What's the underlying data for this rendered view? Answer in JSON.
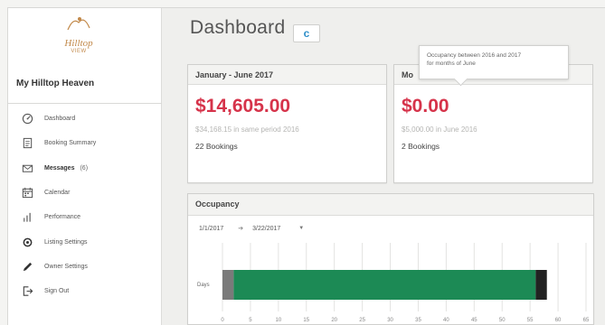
{
  "sidebar": {
    "logo_text": "Hilltop",
    "logo_sub": "VIEW",
    "property_name": "My Hilltop Heaven",
    "items": [
      {
        "label": "Dashboard",
        "icon": "dashboard-icon",
        "bold": false,
        "count": ""
      },
      {
        "label": "Booking Summary",
        "icon": "booking-summary-icon",
        "bold": false,
        "count": ""
      },
      {
        "label": "Messages",
        "icon": "envelope-icon",
        "bold": true,
        "count": "(6)"
      },
      {
        "label": "Calendar",
        "icon": "calendar-icon",
        "bold": false,
        "count": ""
      },
      {
        "label": "Performance",
        "icon": "bar-chart-icon",
        "bold": false,
        "count": ""
      },
      {
        "label": "Listing Settings",
        "icon": "gear-icon",
        "bold": false,
        "count": ""
      },
      {
        "label": "Owner Settings",
        "icon": "pencil-icon",
        "bold": false,
        "count": ""
      },
      {
        "label": "Sign Out",
        "icon": "sign-out-icon",
        "bold": false,
        "count": ""
      }
    ]
  },
  "main": {
    "title": "Dashboard",
    "refresh_label": "c"
  },
  "cards": [
    {
      "header": "January - June 2017",
      "amount": "$14,605.00",
      "comparison": "$34,168.15 in same period 2016",
      "bookings": "22 Bookings"
    },
    {
      "header": "Mo",
      "amount": "$0.00",
      "comparison": "$5,000.00 in June 2016",
      "bookings": "2 Bookings"
    }
  ],
  "tooltip": {
    "line1": "Occupancy between 2016 and 2017",
    "line2": "for months of June"
  },
  "occupancy": {
    "header": "Occupancy",
    "start_date": "1/1/2017",
    "end_date": "3/22/2017",
    "row_label": "Days",
    "accent_color": "#1c8a55"
  },
  "chart_data": {
    "type": "bar",
    "orientation": "horizontal",
    "categories": [
      "Days"
    ],
    "series": [
      {
        "color": "#7a7a7a",
        "start": 0,
        "end": 2
      },
      {
        "color": "#1c8a55",
        "start": 2,
        "end": 56
      },
      {
        "color": "#222222",
        "start": 56,
        "end": 58
      }
    ],
    "x_ticks": [
      "0",
      "5",
      "10",
      "15",
      "20",
      "25",
      "30",
      "35",
      "40",
      "45",
      "50",
      "55",
      "60",
      "65"
    ],
    "xlim": [
      0,
      65
    ],
    "grid": true
  }
}
